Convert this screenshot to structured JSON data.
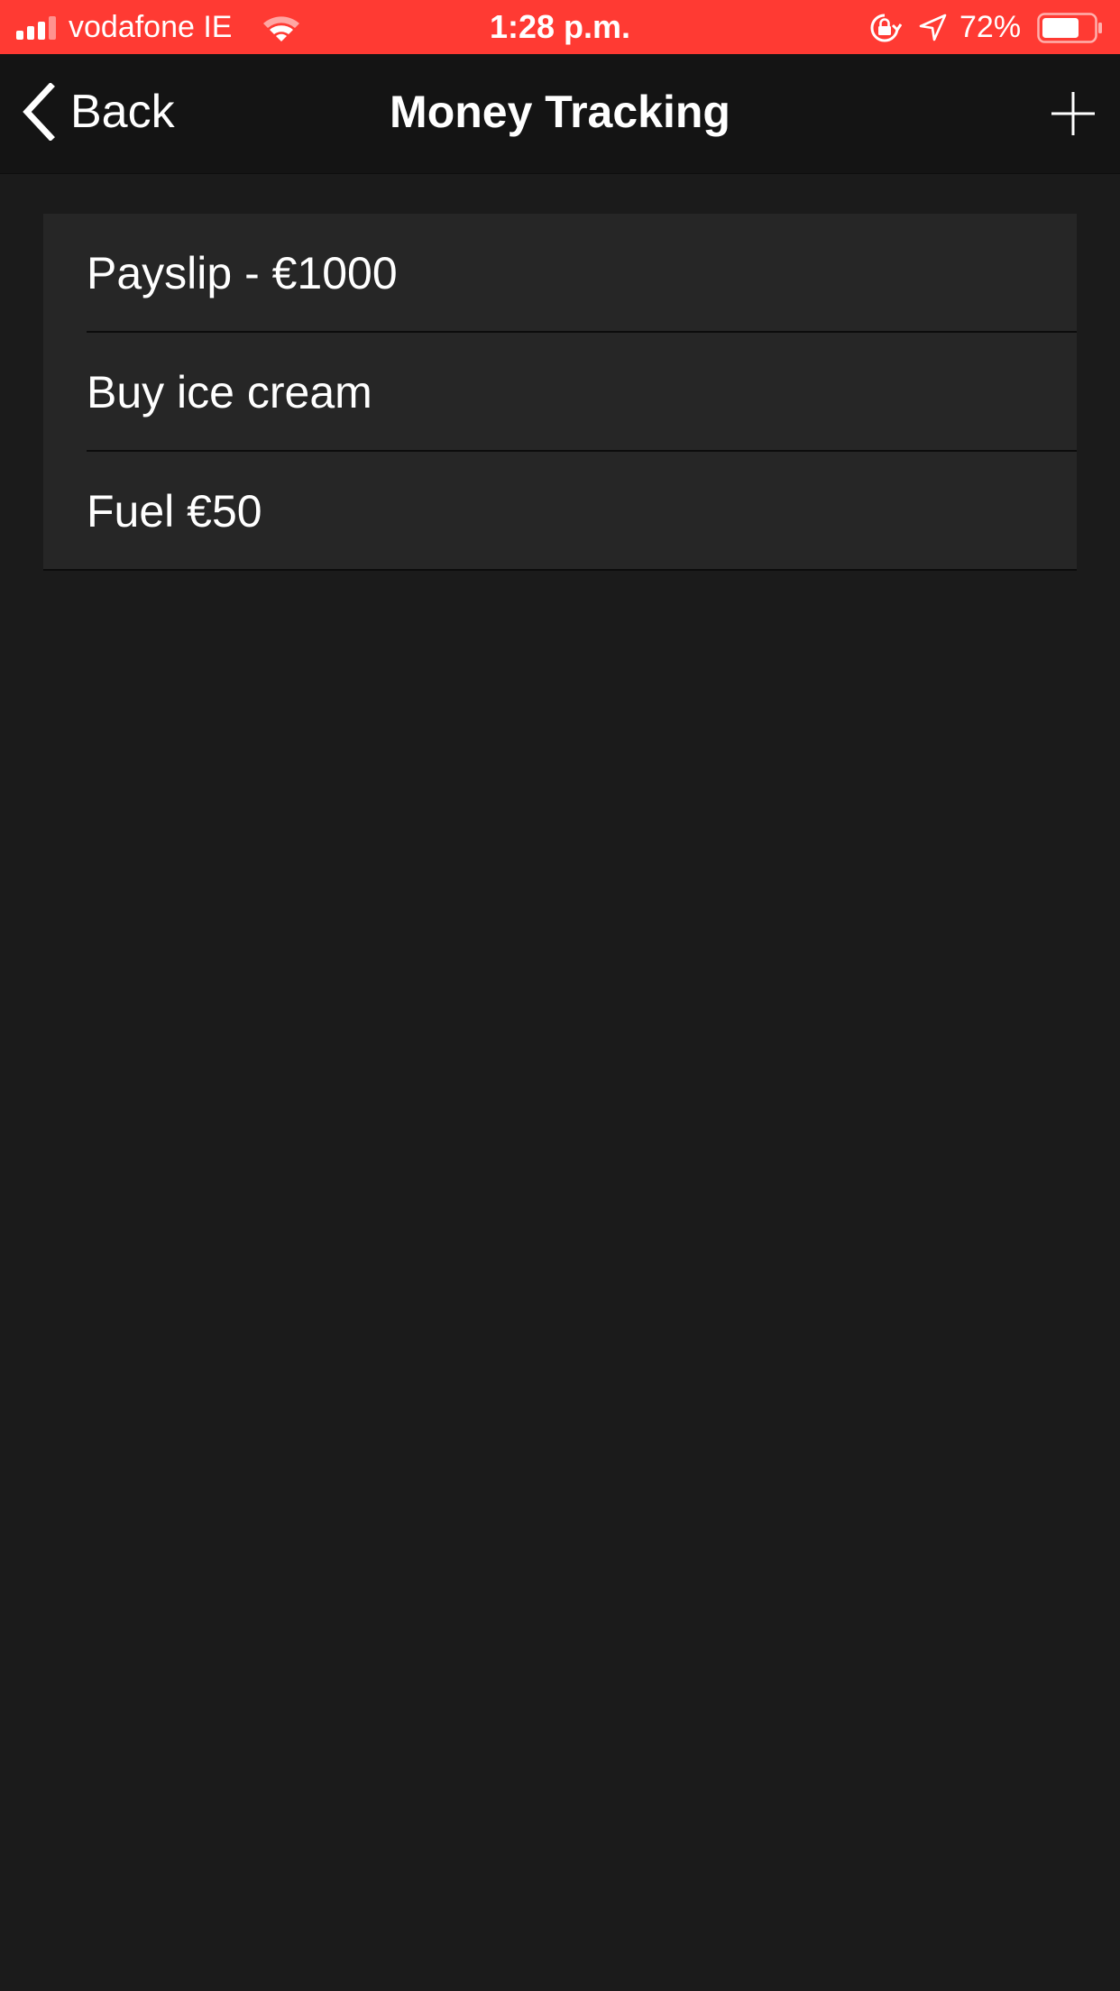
{
  "status_bar": {
    "carrier": "vodafone IE",
    "time": "1:28 p.m.",
    "battery_percent": "72%",
    "battery_level": 0.72,
    "icons": [
      "signal-icon",
      "wifi-icon",
      "rotation-lock-icon",
      "location-arrow-icon",
      "battery-icon"
    ],
    "background_color": "#ff3a33"
  },
  "nav": {
    "back_label": "Back",
    "title": "Money Tracking",
    "back_icon": "chevron-left-icon",
    "add_icon": "plus-icon"
  },
  "list": {
    "items": [
      {
        "label": "Payslip - €1000"
      },
      {
        "label": "Buy ice cream"
      },
      {
        "label": "Fuel €50"
      }
    ]
  },
  "colors": {
    "background": "#1b1b1b",
    "nav_background": "#141414",
    "cell_background": "#262626",
    "text": "#ffffff"
  }
}
